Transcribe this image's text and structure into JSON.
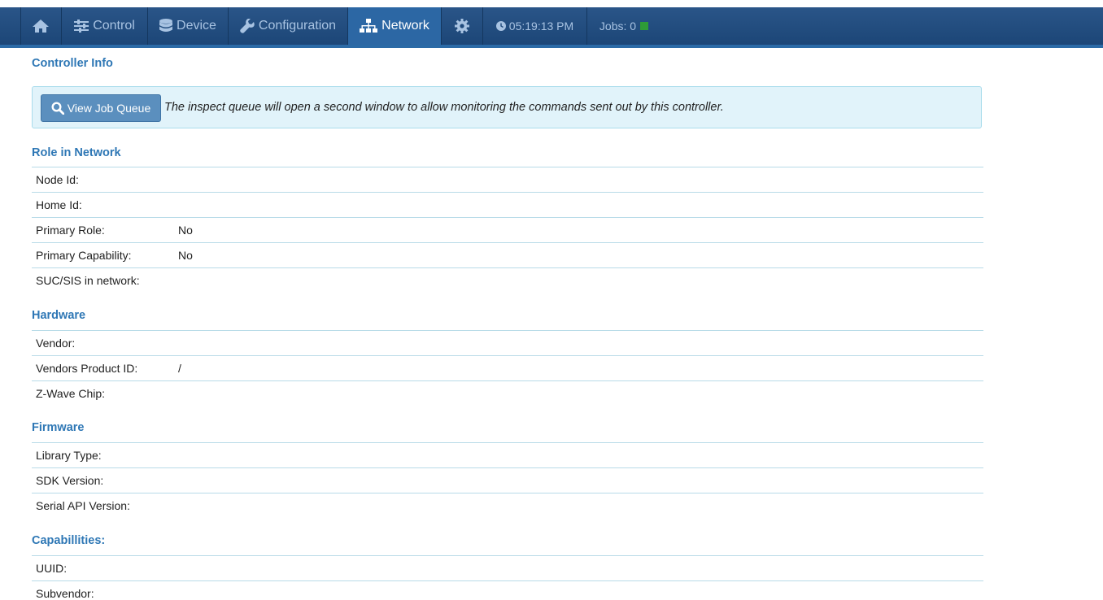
{
  "nav": {
    "items": [
      {
        "label": "",
        "icon": "home-icon"
      },
      {
        "label": "Control",
        "icon": "sliders-icon"
      },
      {
        "label": "Device",
        "icon": "database-icon"
      },
      {
        "label": "Configuration",
        "icon": "wrench-icon"
      },
      {
        "label": "Network",
        "icon": "sitemap-icon",
        "active": true
      },
      {
        "label": "",
        "icon": "gear-icon"
      },
      {
        "label": "05:19:13 PM",
        "icon": "clock-icon"
      },
      {
        "label": "Jobs: 0",
        "icon": "status-square-icon"
      }
    ]
  },
  "page": {
    "title": "Controller Info"
  },
  "alert": {
    "button_label": "View Job Queue",
    "text": "The inspect queue will open a second window to allow monitoring the commands sent out by this controller."
  },
  "sections": {
    "role": {
      "title": "Role in Network",
      "rows": [
        {
          "label": "Node Id:",
          "value": ""
        },
        {
          "label": "Home Id:",
          "value": ""
        },
        {
          "label": "Primary Role:",
          "value": "No"
        },
        {
          "label": "Primary Capability:",
          "value": "No"
        },
        {
          "label": "SUC/SIS in network:",
          "value": ""
        }
      ]
    },
    "hardware": {
      "title": "Hardware",
      "rows": [
        {
          "label": "Vendor:",
          "value": ""
        },
        {
          "label": "Vendors Product ID:",
          "value": "/"
        },
        {
          "label": "Z-Wave Chip:",
          "value": ""
        }
      ]
    },
    "firmware": {
      "title": "Firmware",
      "rows": [
        {
          "label": "Library Type:",
          "value": ""
        },
        {
          "label": "SDK Version:",
          "value": ""
        },
        {
          "label": "Serial API Version:",
          "value": ""
        }
      ]
    },
    "capabilities": {
      "title": "Capabillities:",
      "rows": [
        {
          "label": "UUID:",
          "value": ""
        },
        {
          "label": "Subvendor:",
          "value": ""
        }
      ]
    }
  },
  "colors": {
    "navbar": "#1c4677",
    "nav_active": "#2c67a4",
    "section_title": "#2e77b5",
    "alert_bg": "#e1f3fa",
    "jobs_status": "#2e9b37"
  }
}
